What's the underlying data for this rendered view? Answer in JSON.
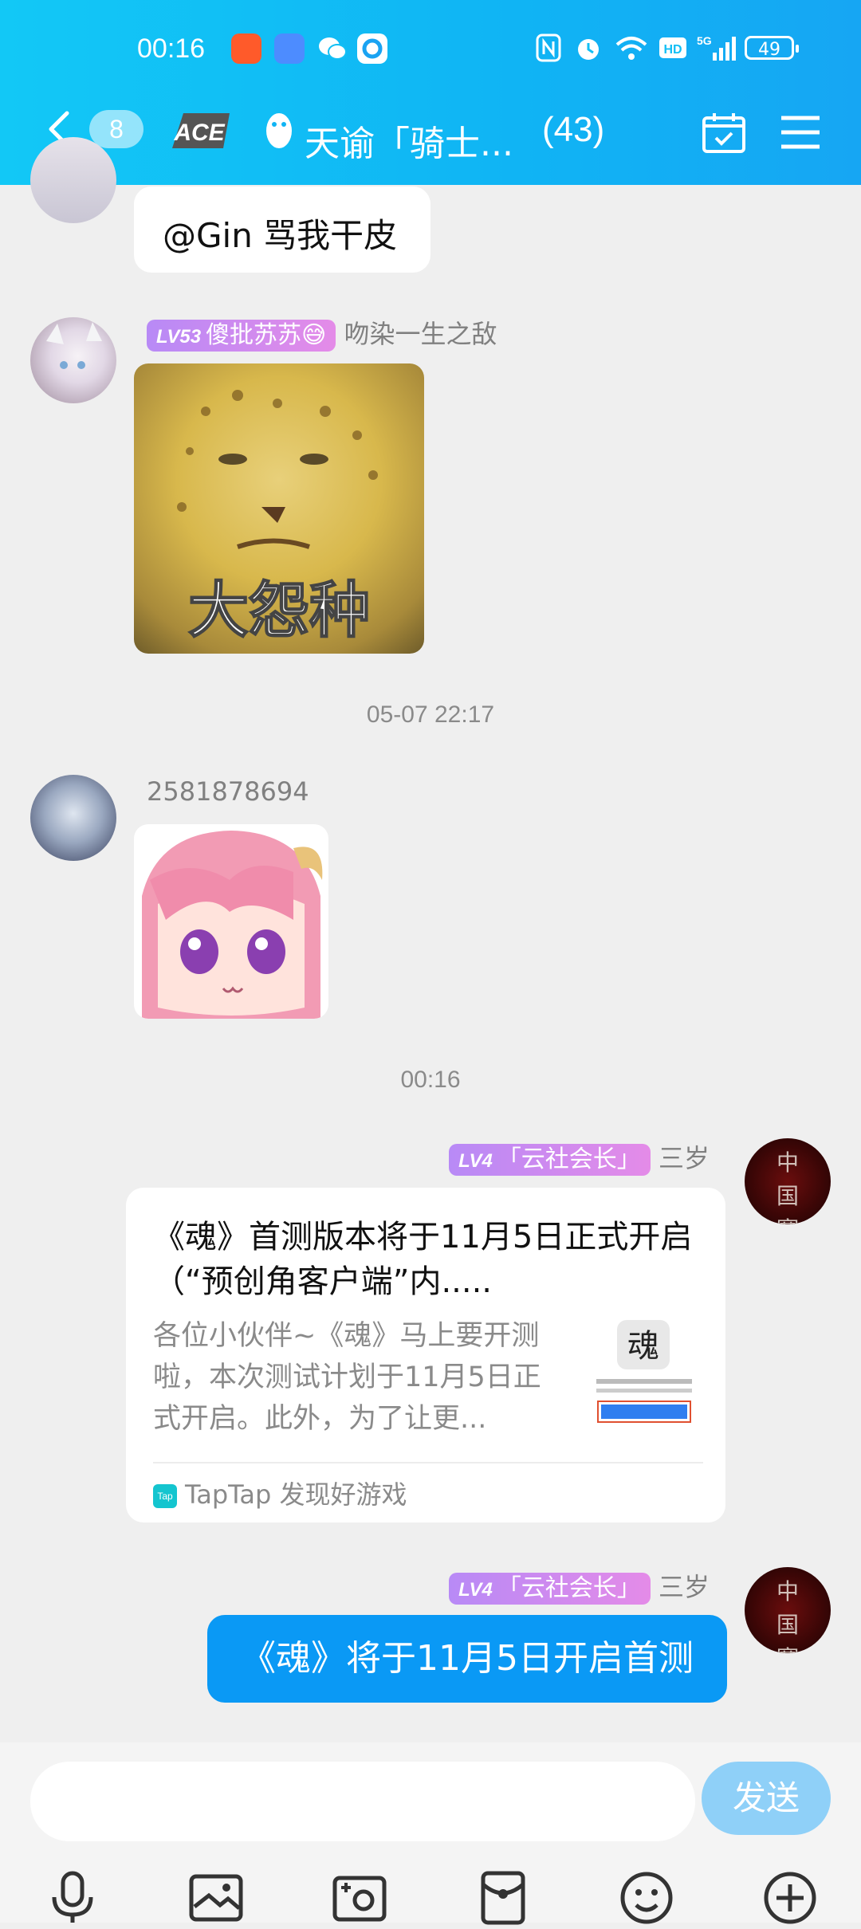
{
  "status_bar": {
    "time": "00:16",
    "battery": "49",
    "network": "5G"
  },
  "header": {
    "unread_count": "8",
    "group_logo_text": "ACE",
    "title": "天谕「骑士...",
    "member_count": "(43)"
  },
  "messages": [
    {
      "type": "text",
      "text": "@Gin 骂我干皮"
    },
    {
      "type": "image",
      "level": "LV53",
      "badge_title": "傻批苏苏😅",
      "sender": "吻染一生之敌",
      "image_caption": "大怨种"
    },
    {
      "type": "timestamp",
      "text": "05-07 22:17"
    },
    {
      "type": "image",
      "sender": "2581878694"
    },
    {
      "type": "timestamp",
      "text": "00:16"
    },
    {
      "type": "card",
      "level": "LV4",
      "badge_title": "「云社会长」",
      "sender": "三岁",
      "card_title": "《魂》首测版本将于11月5日正式开启（“预创角客户端”内.....",
      "card_desc": "各位小伙伴~《魂》马上要开测啦，本次测试计划于11月5日正式开启。此外，为了让更...",
      "thumb_text": "魂",
      "source": "TapTap 发现好游戏",
      "source_icon": "Tap"
    },
    {
      "type": "text",
      "level": "LV4",
      "badge_title": "「云社会长」",
      "sender": "三岁",
      "text": "《魂》将于11月5日开启首测"
    }
  ],
  "avatar_text": "中国赛高",
  "input": {
    "placeholder": "",
    "send_label": "发送"
  },
  "colors": {
    "header": "#10b4f4",
    "bubble_blue": "#0a99f5",
    "send_disabled": "#8fd0f8",
    "badge_purple": "#b88af6"
  }
}
